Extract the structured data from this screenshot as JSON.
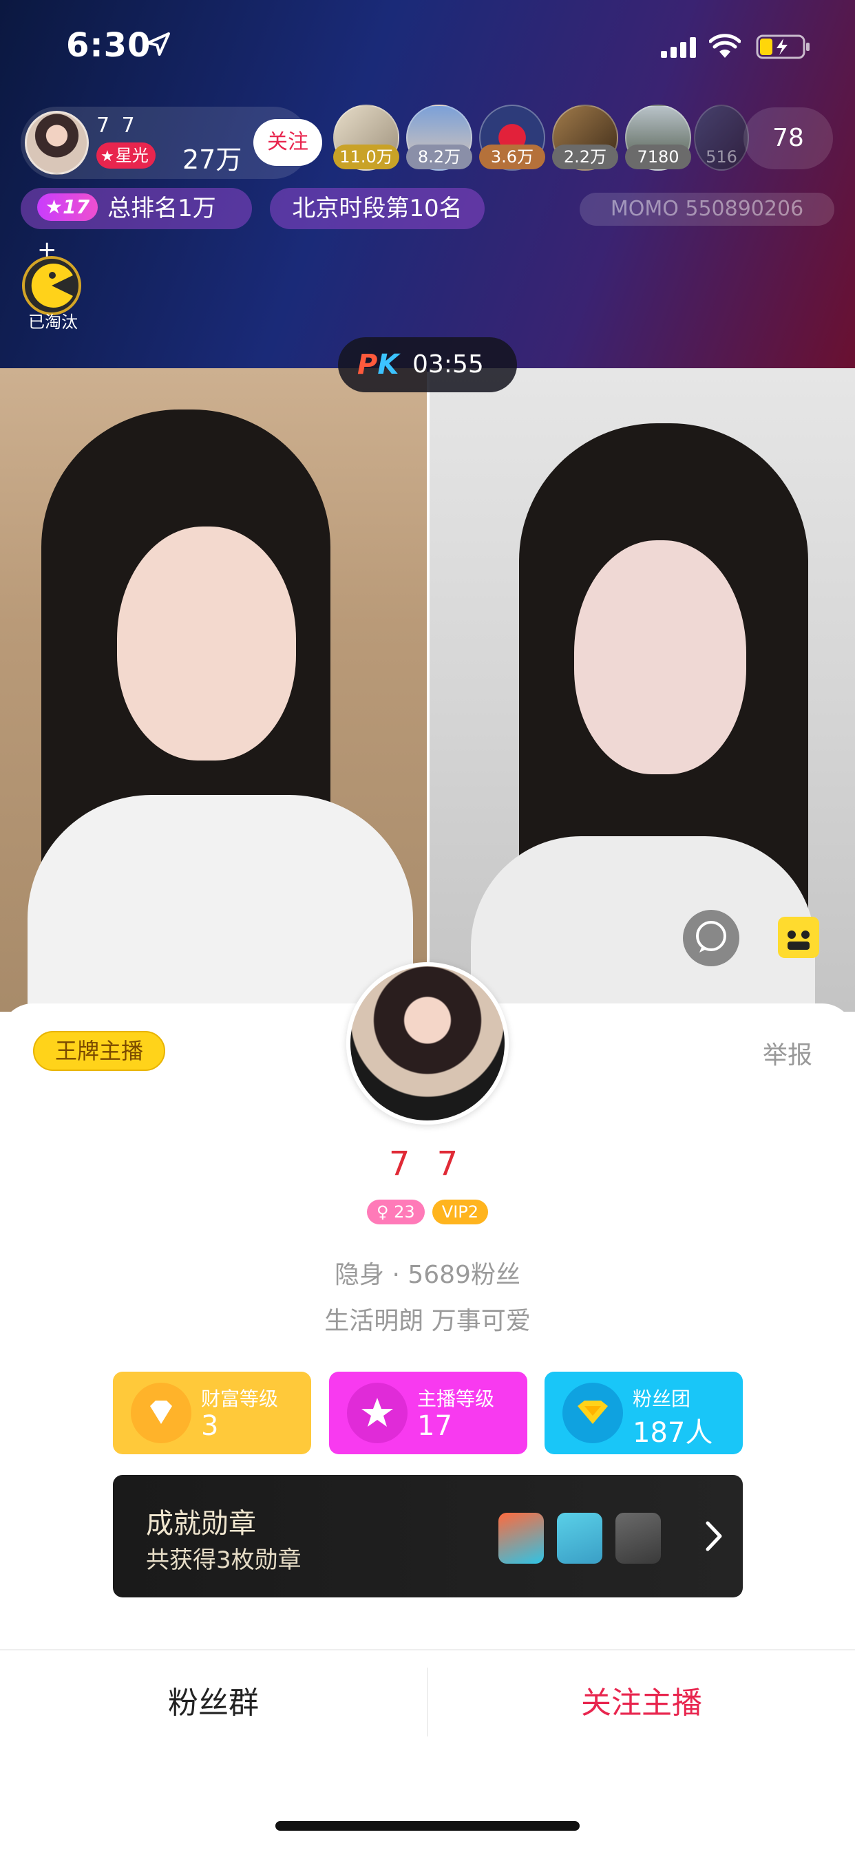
{
  "status_bar": {
    "time": "6:30"
  },
  "anchor": {
    "name": "7 7",
    "badge": "星光",
    "stat": "27万",
    "follow_label": "关注"
  },
  "audience": [
    {
      "amount": "11.0万",
      "tag_color": "#c9a227"
    },
    {
      "amount": "8.2万",
      "tag_color": "#8a8fa8"
    },
    {
      "amount": "3.6万",
      "tag_color": "#b5713a"
    },
    {
      "amount": "2.2万",
      "tag_color": "#6b6b6b"
    },
    {
      "amount": "7180",
      "tag_color": "#6b6b6b"
    },
    {
      "amount": "516",
      "tag_color": "#6b6b6b"
    }
  ],
  "audience_count": "78",
  "rank": {
    "level": "17",
    "text": "总排名1万+"
  },
  "city_rank": "北京时段第10名",
  "momo_id": "MOMO 550890206",
  "eliminated_label": "已淘汰",
  "pk": {
    "time": "03:55"
  },
  "profile": {
    "ace_badge": "王牌主播",
    "report": "举报",
    "name": "7 7",
    "gender_age": "23",
    "vip": "VIP2",
    "meta": "隐身 · 5689粉丝",
    "bio": "生活明朗 万事可爱",
    "stats": [
      {
        "label": "财富等级",
        "value": "3"
      },
      {
        "label": "主播等级",
        "value": "17"
      },
      {
        "label": "粉丝团",
        "value": "187人"
      }
    ],
    "achievement": {
      "title": "成就勋章",
      "subtitle": "共获得3枚勋章"
    }
  },
  "bottom": {
    "fan_group": "粉丝群",
    "follow_anchor": "关注主播"
  },
  "colors": {
    "accent_red": "#e8254e",
    "wealth": "#ffc93a",
    "host": "#f83af0",
    "fans": "#19c6f8",
    "name_red": "#e02a36"
  }
}
